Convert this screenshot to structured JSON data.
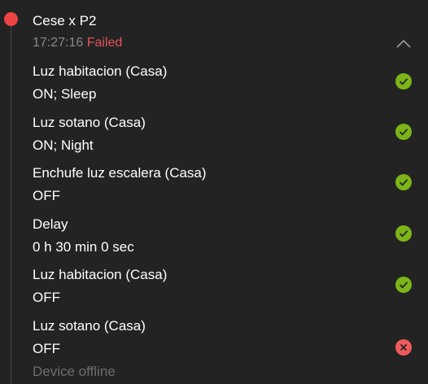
{
  "header": {
    "title": "Cese x P2",
    "time": "17:27:16",
    "status": "Failed",
    "status_color": "#e8535a",
    "timeline_dot_color": "#ef4444",
    "collapse_icon": "chevron-up-icon"
  },
  "steps": [
    {
      "name": "Luz habitacion (Casa)",
      "value": "ON; Sleep",
      "status": "success",
      "icon": "check-circle-icon"
    },
    {
      "name": "Luz sotano (Casa)",
      "value": "ON; Night",
      "status": "success",
      "icon": "check-circle-icon"
    },
    {
      "name": "Enchufe luz escalera (Casa)",
      "value": "OFF",
      "status": "success",
      "icon": "check-circle-icon"
    },
    {
      "name": "Delay",
      "value": "0 h 30 min 0 sec",
      "status": "success",
      "icon": "check-circle-icon"
    },
    {
      "name": "Luz habitacion (Casa)",
      "value": "OFF",
      "status": "success",
      "icon": "check-circle-icon"
    },
    {
      "name": "Luz sotano (Casa)",
      "value": "OFF",
      "status": "error",
      "icon": "error-circle-icon",
      "error": "Device offline"
    }
  ],
  "colors": {
    "success": "#7cb518",
    "error": "#ef5a5a",
    "background": "#232323"
  }
}
